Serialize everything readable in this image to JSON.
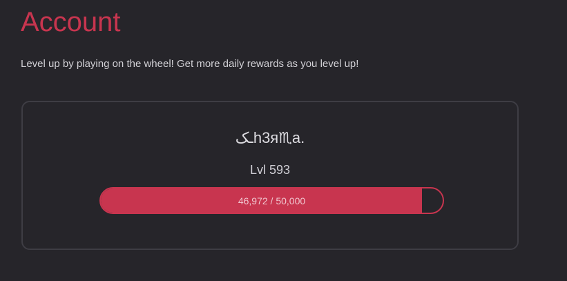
{
  "page": {
    "title": "Account",
    "subtitle": "Level up by playing on the wheel! Get more daily rewards as you level up!"
  },
  "profile": {
    "username": "ـکh3я♏a.",
    "level_text": "Lvl 593",
    "xp_current": 46972,
    "xp_max": 50000,
    "progress_text": "46,972 / 50,000"
  },
  "colors": {
    "accent": "#c8354f",
    "background": "#26252a",
    "card_border": "#3e3d44"
  }
}
